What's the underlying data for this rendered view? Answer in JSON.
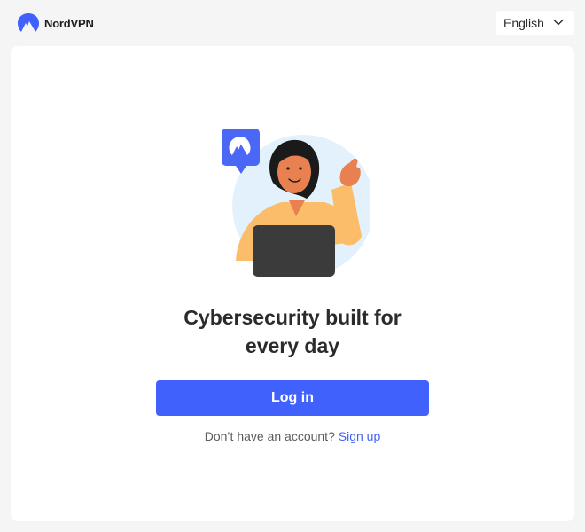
{
  "header": {
    "logo_text": "NordVPN",
    "logo_icon": "nordvpn-mountain-icon",
    "language": {
      "selected": "English",
      "icon": "chevron-down-icon"
    }
  },
  "main": {
    "illustration": "person-waving-at-laptop",
    "headline_line1": "Cybersecurity built for",
    "headline_line2": "every day",
    "login_label": "Log in",
    "signup_prompt": "Don’t have an account?",
    "signup_link": "Sign up"
  },
  "colors": {
    "accent": "#4161fd",
    "background": "#f5f5f5",
    "card": "#ffffff",
    "text": "#2b2b2b"
  }
}
